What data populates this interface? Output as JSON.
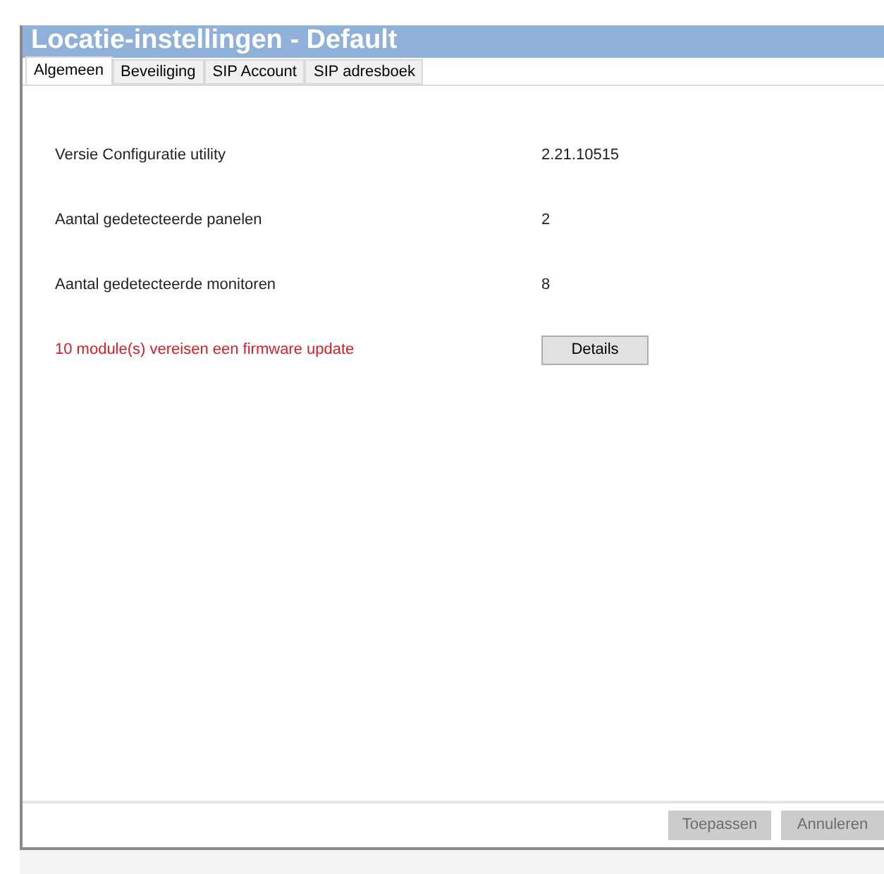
{
  "window": {
    "title": "Locatie-instellingen - Default"
  },
  "tabs": [
    {
      "label": "Algemeen",
      "selected": true
    },
    {
      "label": "Beveiliging",
      "selected": false
    },
    {
      "label": "SIP Account",
      "selected": false
    },
    {
      "label": "SIP adresboek",
      "selected": false
    }
  ],
  "rows": [
    {
      "kind": "info",
      "label": "Versie Configuratie utility",
      "value": "2.21.10515"
    },
    {
      "kind": "info",
      "label": "Aantal gedetecteerde panelen",
      "value": "2"
    },
    {
      "kind": "info",
      "label": "Aantal gedetecteerde monitoren",
      "value": "8"
    },
    {
      "kind": "warning",
      "label": "10 module(s) vereisen een firmware update",
      "button": "Details"
    }
  ],
  "buttons": [
    {
      "label": "Toepassen",
      "disabled": true
    },
    {
      "label": "Annuleren",
      "disabled": true
    }
  ]
}
